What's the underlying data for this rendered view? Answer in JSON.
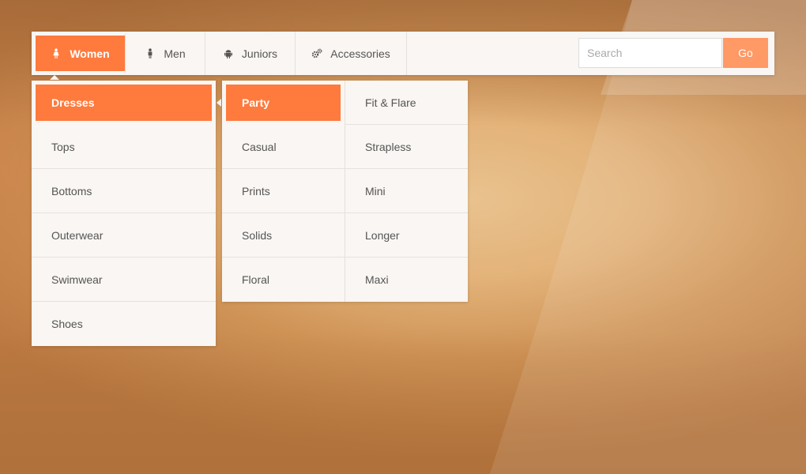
{
  "nav": {
    "items": [
      {
        "label": "Women",
        "icon": "woman-icon",
        "active": true
      },
      {
        "label": "Men",
        "icon": "man-icon",
        "active": false
      },
      {
        "label": "Juniors",
        "icon": "android-icon",
        "active": false
      },
      {
        "label": "Accessories",
        "icon": "gears-icon",
        "active": false
      }
    ],
    "search_placeholder": "Search",
    "search_value": "",
    "go_label": "Go"
  },
  "submenu": {
    "items": [
      "Dresses",
      "Tops",
      "Bottoms",
      "Outerwear",
      "Swimwear",
      "Shoes"
    ],
    "active": "Dresses"
  },
  "dresses_menu": {
    "col1": [
      "Party",
      "Casual",
      "Prints",
      "Solids",
      "Floral"
    ],
    "col2": [
      "Fit & Flare",
      "Strapless",
      "Mini",
      "Longer",
      "Maxi"
    ],
    "active": "Party"
  },
  "colors": {
    "accent": "#ff7a3d",
    "go_button": "#ff9966",
    "panel": "#f9f6f3",
    "text": "#555555"
  }
}
